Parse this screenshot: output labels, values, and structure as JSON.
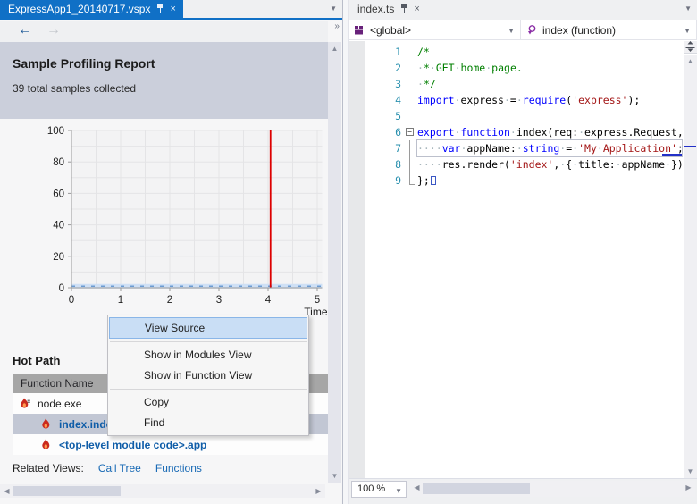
{
  "left_pane": {
    "tab_title": "ExpressApp1_20140717.vspx",
    "report": {
      "title": "Sample Profiling Report",
      "subtitle": "39 total samples collected"
    },
    "hot_path": {
      "title": "Hot Path",
      "column_header": "Function Name",
      "rows": [
        {
          "label": "node.exe",
          "indent": 0,
          "style": "plain",
          "selected": false,
          "icon": "flame-root-icon"
        },
        {
          "label": "index.index",
          "indent": 1,
          "style": "link",
          "selected": true,
          "icon": "flame-icon"
        },
        {
          "label": "<top-level module code>.app",
          "indent": 1,
          "style": "link",
          "selected": false,
          "icon": "flame-icon"
        }
      ]
    },
    "related_views": {
      "label": "Related Views:",
      "links": [
        "Call Tree",
        "Functions"
      ]
    }
  },
  "chart_data": {
    "type": "line",
    "title": "",
    "xlabel": "Time",
    "ylabel": "",
    "xlim": [
      0,
      5.1
    ],
    "ylim": [
      0,
      100
    ],
    "x_ticks": [
      0,
      1,
      2,
      3,
      4,
      5
    ],
    "y_ticks": [
      0,
      20,
      40,
      60,
      80,
      100
    ],
    "x_minor_grid": 0.5,
    "y_minor_grid": 10,
    "grid": true,
    "legend": "none",
    "series": [
      {
        "name": "cpu-usage",
        "type": "flat-line",
        "y": 1,
        "x_start": 0,
        "x_end": 5.1,
        "color": "#6b9bd2",
        "band_color": "#cfe0f5"
      },
      {
        "name": "current-position-marker",
        "type": "vline",
        "x": 4.05,
        "y_top": 100,
        "y_bottom": 0,
        "color": "#dd0000"
      }
    ]
  },
  "context_menu": {
    "items": [
      {
        "type": "item",
        "label": "View Source",
        "highlighted": true
      },
      {
        "type": "separator"
      },
      {
        "type": "item",
        "label": "Show in Modules View",
        "highlighted": false
      },
      {
        "type": "item",
        "label": "Show in Function View",
        "highlighted": false
      },
      {
        "type": "separator"
      },
      {
        "type": "item",
        "label": "Copy",
        "highlighted": false
      },
      {
        "type": "item",
        "label": "Find",
        "highlighted": false
      }
    ]
  },
  "right_pane": {
    "tab_title": "index.ts",
    "nav": {
      "scope": "<global>",
      "member": "index (function)"
    },
    "zoom_level": "100 %",
    "editor_lines": [
      {
        "n": 1,
        "fold": "",
        "current": false,
        "tokens": [
          [
            "com",
            "/*"
          ]
        ]
      },
      {
        "n": 2,
        "fold": "",
        "current": false,
        "tokens": [
          [
            "ws",
            "·"
          ],
          [
            "com",
            "*"
          ],
          [
            "ws",
            "·"
          ],
          [
            "com",
            "GET"
          ],
          [
            "ws",
            "·"
          ],
          [
            "com",
            "home"
          ],
          [
            "ws",
            "·"
          ],
          [
            "com",
            "page."
          ]
        ]
      },
      {
        "n": 3,
        "fold": "",
        "current": false,
        "tokens": [
          [
            "ws",
            "·"
          ],
          [
            "com",
            "*/"
          ]
        ]
      },
      {
        "n": 4,
        "fold": "",
        "current": false,
        "tokens": [
          [
            "kw",
            "import"
          ],
          [
            "ws",
            "·"
          ],
          [
            "pln",
            "express"
          ],
          [
            "ws",
            "·"
          ],
          [
            "pln",
            "="
          ],
          [
            "ws",
            "·"
          ],
          [
            "kw",
            "require"
          ],
          [
            "pln",
            "("
          ],
          [
            "str",
            "'express'"
          ],
          [
            "pln",
            ");"
          ]
        ]
      },
      {
        "n": 5,
        "fold": "",
        "current": false,
        "tokens": []
      },
      {
        "n": 6,
        "fold": "start",
        "current": false,
        "tokens": [
          [
            "kw",
            "export"
          ],
          [
            "ws",
            "·"
          ],
          [
            "kw",
            "function"
          ],
          [
            "ws",
            "·"
          ],
          [
            "pln",
            "index(req:"
          ],
          [
            "ws",
            "·"
          ],
          [
            "pln",
            "express.Request,"
          ]
        ]
      },
      {
        "n": 7,
        "fold": "mid",
        "current": true,
        "caret_tail": true,
        "tokens": [
          [
            "ws",
            "····"
          ],
          [
            "kw",
            "var"
          ],
          [
            "ws",
            "·"
          ],
          [
            "pln",
            "appName:"
          ],
          [
            "ws",
            "·"
          ],
          [
            "kw",
            "string"
          ],
          [
            "ws",
            "·"
          ],
          [
            "pln",
            "="
          ],
          [
            "ws",
            "·"
          ],
          [
            "str",
            "'My"
          ],
          [
            "ws",
            "·"
          ],
          [
            "str",
            "Application'"
          ],
          [
            "pln",
            ";"
          ]
        ]
      },
      {
        "n": 8,
        "fold": "mid",
        "current": false,
        "tokens": [
          [
            "ws",
            "····"
          ],
          [
            "pln",
            "res.render("
          ],
          [
            "str",
            "'index'"
          ],
          [
            "pln",
            ","
          ],
          [
            "ws",
            "·"
          ],
          [
            "pln",
            "{"
          ],
          [
            "ws",
            "·"
          ],
          [
            "pln",
            "title:"
          ],
          [
            "ws",
            "·"
          ],
          [
            "pln",
            "appName"
          ],
          [
            "ws",
            "·"
          ],
          [
            "pln",
            "})"
          ]
        ]
      },
      {
        "n": 9,
        "fold": "end",
        "current": false,
        "eof": true,
        "tokens": [
          [
            "pln",
            "};"
          ]
        ]
      }
    ]
  },
  "icons": {
    "pin": "pin-icon",
    "close": "×",
    "back_arrow": "←",
    "forward_arrow": "→",
    "overflow": "››",
    "dropdown_arrow": "▼",
    "scroll_up": "▲",
    "scroll_down": "▼",
    "scroll_left": "◀",
    "scroll_right": "▶",
    "fold_collapse": "−"
  },
  "colors": {
    "accent_tab_blue": "#1070c6",
    "header_band": "#cbcfdb",
    "selected_row": "#c2c7d4",
    "table_header": "#a6a6a6",
    "link_blue": "#0f5da8",
    "menu_highlight": "#c9def5",
    "keyword": "#0000ff",
    "comment": "#007f00",
    "string": "#a31515",
    "line_number": "#2b91af",
    "marker_red": "#dd0000",
    "series_blue": "#6b9bd2",
    "vs_purple": "#68217a"
  }
}
